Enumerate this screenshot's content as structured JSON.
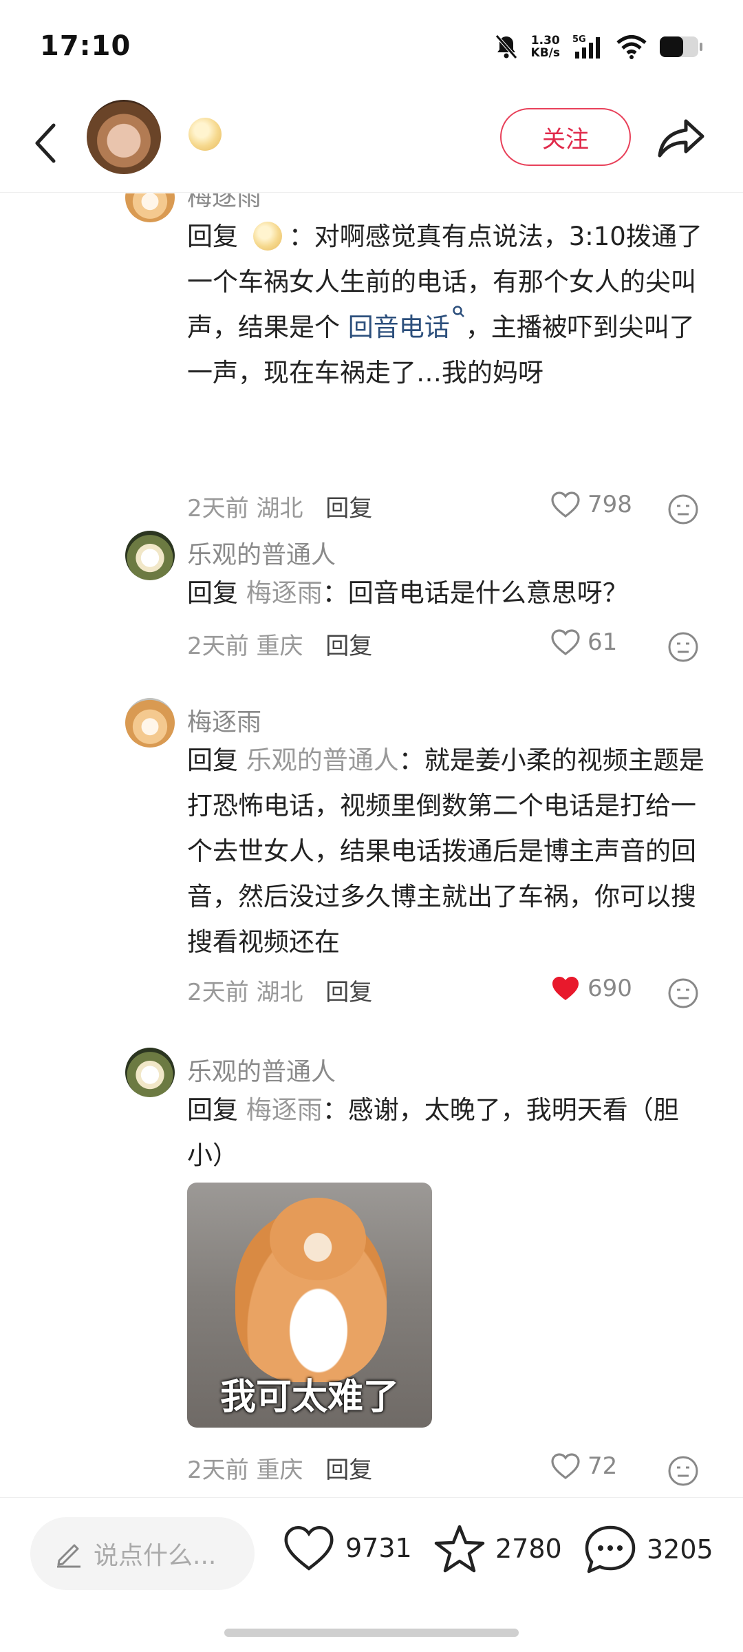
{
  "status": {
    "time": "17:10",
    "net_speed": "1.30",
    "net_unit": "KB/s",
    "network": "5G"
  },
  "header": {
    "follow_label": "关注"
  },
  "comments": [
    {
      "user": "梅逐雨",
      "reply_prefix": "回复",
      "text_before": "：对啊感觉真有点说法，3:10拨通了一个车祸女人生前的电话，有那个女人的尖叫声，结果是个",
      "keyword": "回音电话",
      "text_after": "，主播被吓到尖叫了一声，现在车祸走了…我的妈呀",
      "time": "2天前",
      "location": "湖北",
      "reply_label": "回复",
      "likes": "798"
    },
    {
      "user": "乐观的普通人",
      "reply_prefix": "回复",
      "reply_to": "梅逐雨",
      "text": "：回音电话是什么意思呀？",
      "time": "2天前",
      "location": "重庆",
      "reply_label": "回复",
      "likes": "61"
    },
    {
      "user": "梅逐雨",
      "reply_prefix": "回复",
      "reply_to": "乐观的普通人",
      "text": "：就是姜小柔的视频主题是打恐怖电话，视频里倒数第二个电话是打给一个去世女人，结果电话拨通后是博主声音的回音，然后没过多久博主就出了车祸，你可以搜搜看视频还在",
      "time": "2天前",
      "location": "湖北",
      "reply_label": "回复",
      "likes": "690",
      "liked": true
    },
    {
      "user": "乐观的普通人",
      "reply_prefix": "回复",
      "reply_to": "梅逐雨",
      "text": "：感谢，太晚了，我明天看（胆小）",
      "sticker_caption": "我可太难了",
      "time": "2天前",
      "location": "重庆",
      "reply_label": "回复",
      "likes": "72"
    }
  ],
  "bottom": {
    "input_placeholder": "说点什么...",
    "likes": "9731",
    "stars": "2780",
    "comments": "3205"
  },
  "colors": {
    "accent": "#e0294a",
    "keyword": "#2c4f7c",
    "liked_heart": "#e8192c"
  }
}
